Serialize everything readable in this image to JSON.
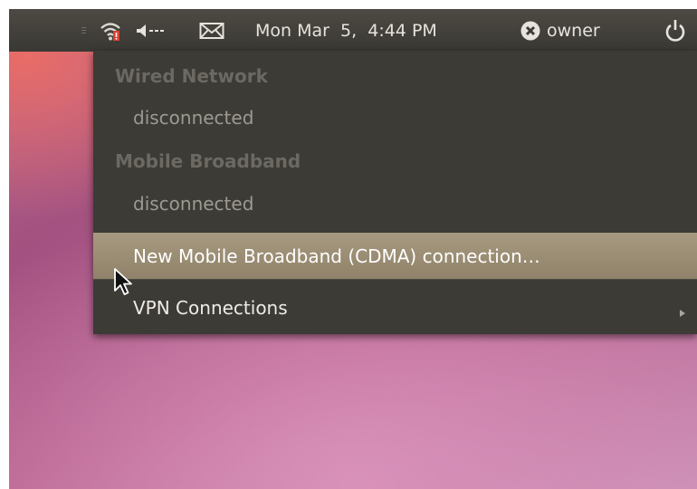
{
  "panel": {
    "datetime": "Mon Mar  5,  4:44 PM",
    "username": "owner",
    "icons": [
      "handle-icon",
      "wifi-icon",
      "volume-icon",
      "mail-icon",
      "user-status-icon",
      "power-icon"
    ]
  },
  "menu": {
    "wired_header": "Wired Network",
    "wired_status": "disconnected",
    "mobile_header": "Mobile Broadband",
    "mobile_status": "disconnected",
    "new_mobile_connection": "New Mobile Broadband (CDMA) connection…",
    "vpn_connections": "VPN Connections"
  },
  "colors": {
    "panel_bg": "#3c3b37",
    "menu_bg": "#3d3b36",
    "highlight": "#9d8f74",
    "wifi_alert": "#e04030"
  }
}
